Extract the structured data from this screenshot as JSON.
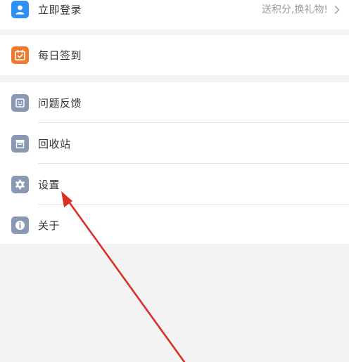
{
  "colors": {
    "login_icon": "#2e90f2",
    "checkin_icon": "#ef7a2e",
    "gray_icon": "#8a99b3",
    "arrow": "#d9302a"
  },
  "account": {
    "login_label": "立即登录",
    "login_hint": "送积分,换礼物!",
    "login_icon": "user-icon",
    "chevron_icon": "chevron-right-icon"
  },
  "checkin": {
    "label": "每日签到",
    "icon": "calendar-check-icon"
  },
  "menu": {
    "items": [
      {
        "label": "问题反馈",
        "icon": "feedback-smile-icon"
      },
      {
        "label": "回收站",
        "icon": "recycle-bin-icon"
      },
      {
        "label": "设置",
        "icon": "gear-icon"
      },
      {
        "label": "关于",
        "icon": "info-icon"
      }
    ]
  },
  "annotation": {
    "type": "red-arrow",
    "points_to": "设置"
  }
}
